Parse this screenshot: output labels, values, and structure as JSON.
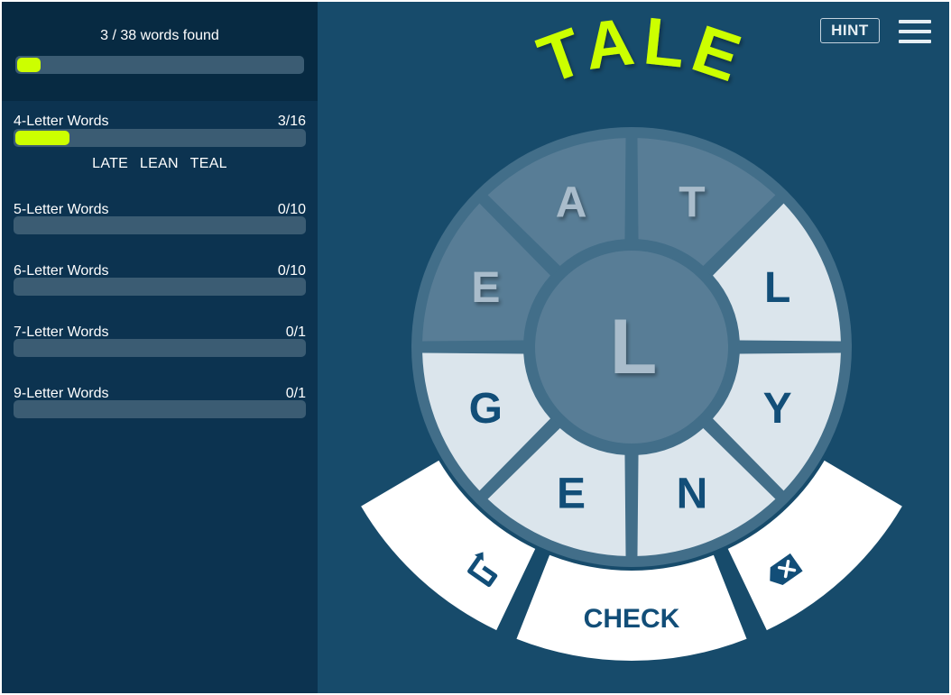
{
  "summary": {
    "progress_text": "3 / 38 words found",
    "progress_fraction": 0.079
  },
  "categories": [
    {
      "label": "4-Letter Words",
      "count": "3/16",
      "fraction": 0.1875
    },
    {
      "label": "5-Letter Words",
      "count": "0/10",
      "fraction": 0
    },
    {
      "label": "6-Letter Words",
      "count": "0/10",
      "fraction": 0
    },
    {
      "label": "7-Letter Words",
      "count": "0/1",
      "fraction": 0
    },
    {
      "label": "9-Letter Words",
      "count": "0/1",
      "fraction": 0
    }
  ],
  "found_words": [
    "LATE",
    "LEAN",
    "TEAL"
  ],
  "header": {
    "hint_label": "HINT",
    "menu_icon": "hamburger-menu-icon"
  },
  "current_word": "TALE",
  "wheel": {
    "center_letter": "L",
    "letters": [
      "T",
      "L",
      "Y",
      "N",
      "E",
      "G",
      "E",
      "A"
    ],
    "selected": [
      true,
      false,
      false,
      false,
      false,
      false,
      true,
      true
    ]
  },
  "controls": {
    "check_label": "CHECK",
    "undo_icon": "undo-arrow-icon",
    "clear_icon": "backspace-clear-icon"
  },
  "colors": {
    "accent": "#ccff00",
    "background": "#174b6b",
    "sidebar": "#0c3350",
    "segment_selected": "#587d96",
    "segment_unselected": "#dbe5ec",
    "letter_unselected": "#124e78",
    "letter_selected": "#a9bccb",
    "ring": "#426e89"
  }
}
